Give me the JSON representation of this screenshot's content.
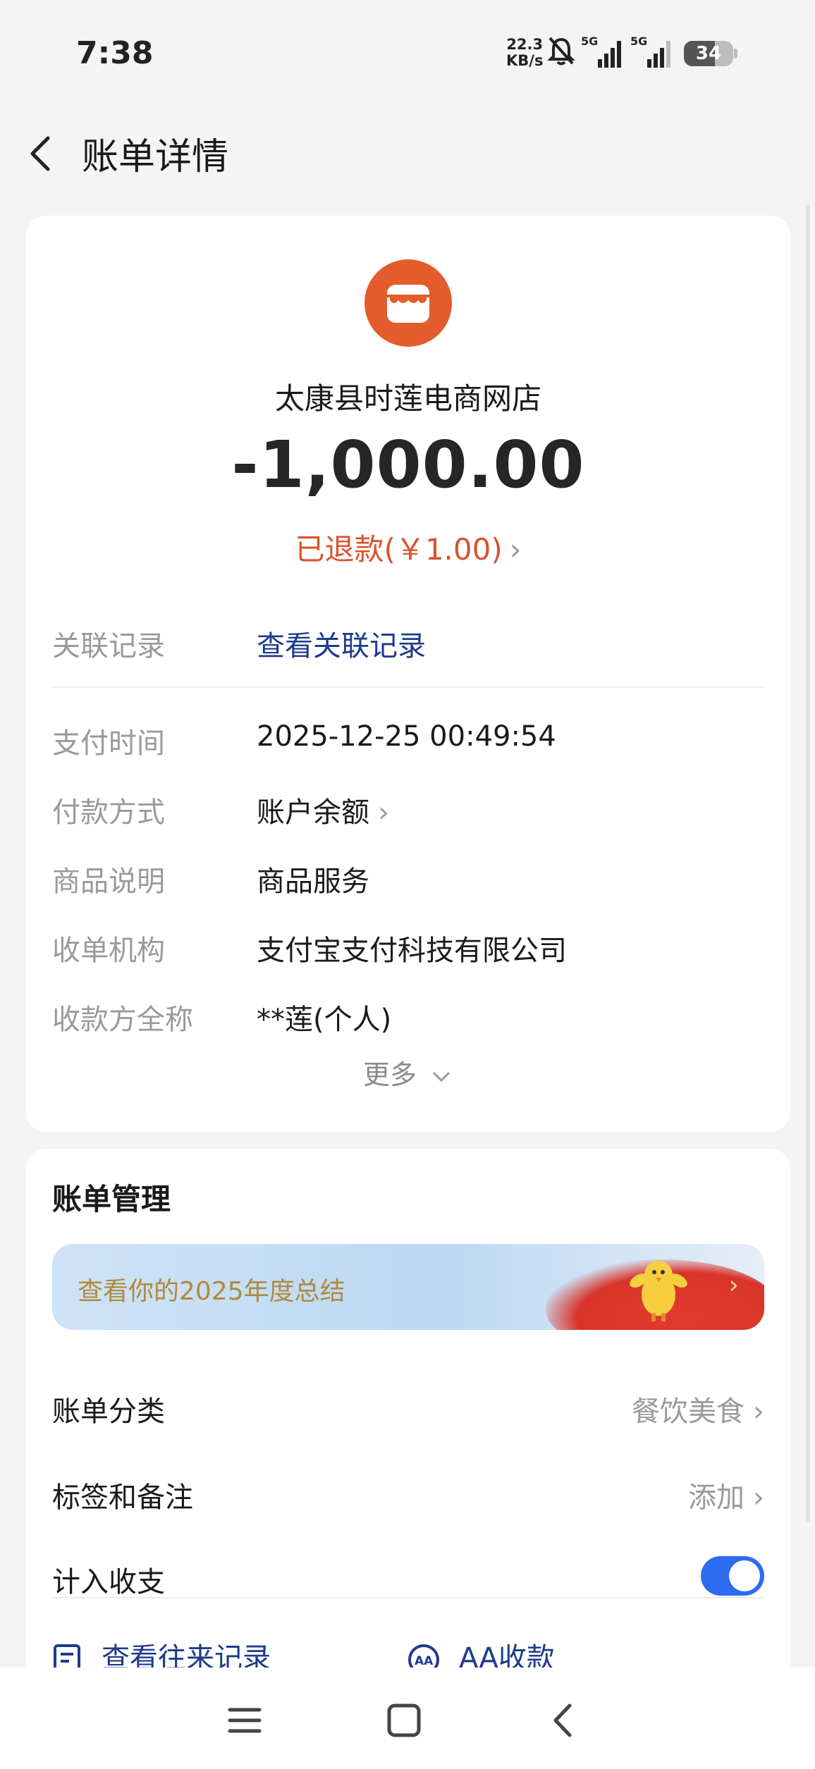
{
  "status_bar": {
    "time": "7:38",
    "net_speed_value": "22.3",
    "net_speed_unit": "KB/s",
    "battery": "34",
    "icons": [
      "bell-muted-icon",
      "signal-5g-icon",
      "signal-5g-icon",
      "battery-icon"
    ]
  },
  "header": {
    "back_icon": "chevron-left-icon",
    "title": "账单详情"
  },
  "summary": {
    "merchant_icon": "shop-icon",
    "merchant_color": "#e45c2b",
    "merchant_name": "太康县时莲电商网店",
    "amount": "-1,000.00",
    "refund_text": "已退款(￥1.00)",
    "refund_color": "#d9532c"
  },
  "details": {
    "related": {
      "label": "关联记录",
      "value": "查看关联记录"
    },
    "rows": [
      {
        "label": "支付时间",
        "value": "2025-12-25 00:49:54"
      },
      {
        "label": "付款方式",
        "value": "账户余额"
      },
      {
        "label": "商品说明",
        "value": "商品服务"
      },
      {
        "label": "收单机构",
        "value": "支付宝支付科技有限公司"
      },
      {
        "label": "收款方全称",
        "value": "**莲(个人)"
      }
    ],
    "more": "更多"
  },
  "management": {
    "title": "账单管理",
    "banner_text": "查看你的2025年度总结",
    "category": {
      "label": "账单分类",
      "value": "餐饮美食"
    },
    "tags": {
      "label": "标签和备注",
      "value": "添加"
    },
    "include": {
      "label": "计入收支",
      "enabled": true
    },
    "link_history": "查看往来记录",
    "link_aa": "AA收款"
  },
  "nav": {
    "icons": [
      "menu-icon",
      "home-square-icon",
      "back-triangle-icon"
    ]
  },
  "colors": {
    "link": "#1e3a8a",
    "toggle_on": "#2f6bf0"
  }
}
